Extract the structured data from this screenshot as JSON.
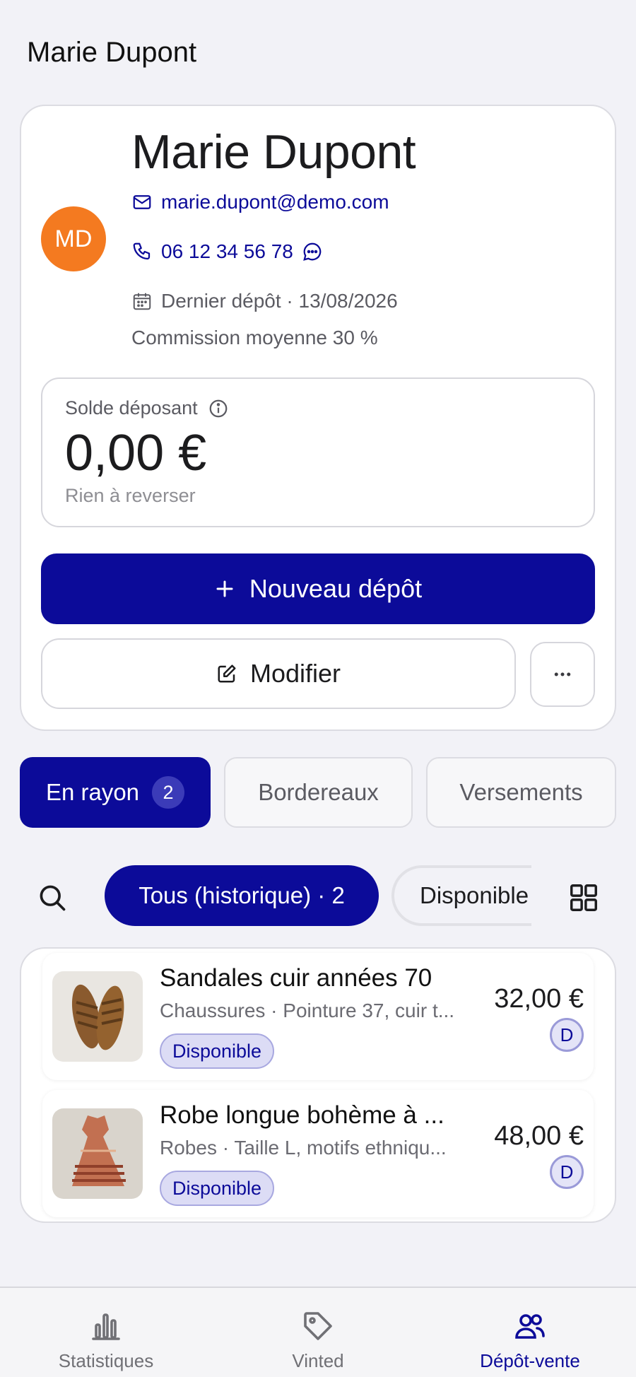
{
  "header": {
    "title": "Marie Dupont"
  },
  "client": {
    "initials": "MD",
    "name": "Marie Dupont",
    "email": "marie.dupont@demo.com",
    "phone": "06 12 34 56 78",
    "last_deposit": "Dernier dépôt · 13/08/2026",
    "commission": "Commission moyenne 30 %",
    "avatar_color": "#f47a20"
  },
  "balance": {
    "label": "Solde déposant",
    "value": "0,00 €",
    "note": "Rien à reverser"
  },
  "actions": {
    "new_deposit": "Nouveau dépôt",
    "edit": "Modifier"
  },
  "tabs": [
    {
      "label": "En rayon",
      "badge": "2"
    },
    {
      "label": "Bordereaux"
    },
    {
      "label": "Versements"
    }
  ],
  "filters": {
    "active": "Tous (historique) · 2",
    "next": "Disponible"
  },
  "items": [
    {
      "title": "Sandales cuir années 70",
      "subtitle": "Chaussures · Pointure 37, cuir t...",
      "status": "Disponible",
      "price": "32,00 €",
      "type": "D"
    },
    {
      "title": "Robe longue bohème à ...",
      "subtitle": "Robes · Taille L, motifs ethniqu...",
      "status": "Disponible",
      "price": "48,00 €",
      "type": "D"
    }
  ],
  "nav": [
    {
      "label": "Statistiques",
      "icon": "bar-chart-icon"
    },
    {
      "label": "Vinted",
      "icon": "tag-icon"
    },
    {
      "label": "Dépôt-vente",
      "icon": "users-icon"
    }
  ],
  "colors": {
    "accent": "#0c0b99",
    "background": "#f2f2f7"
  }
}
